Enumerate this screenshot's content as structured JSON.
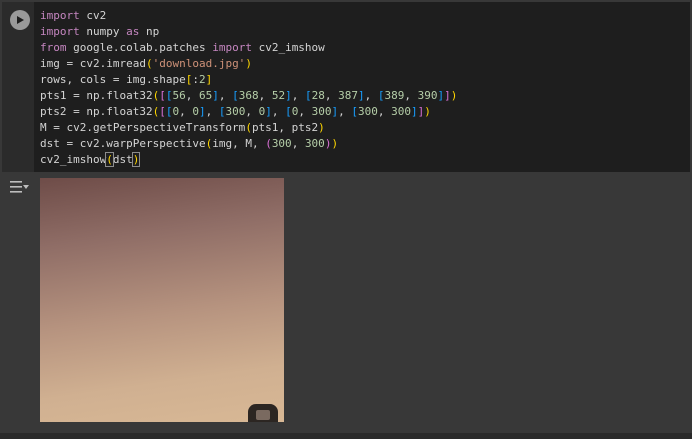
{
  "code_lines": [
    "import cv2",
    "import numpy as np",
    "from google.colab.patches import cv2_imshow",
    "img = cv2.imread('download.jpg')",
    "rows, cols = img.shape[:2]",
    "pts1 = np.float32([[56, 65], [368, 52], [28, 387], [389, 390]])",
    "pts2 = np.float32([[0, 0], [300, 0], [0, 300], [300, 300]])",
    "M = cv2.getPerspectiveTransform(pts1, pts2)",
    "dst = cv2.warpPerspective(img, M, (300, 300))",
    "cv2_imshow(dst)"
  ],
  "icons": {
    "run": "play-icon",
    "output_toggle": "output-toggle-icon"
  },
  "colors": {
    "keyword": "#c586c0",
    "string": "#ce9178",
    "number": "#b5cea8",
    "text": "#d4d4d4",
    "code_bg": "#1e1e1e",
    "cell_bg": "#383838"
  }
}
